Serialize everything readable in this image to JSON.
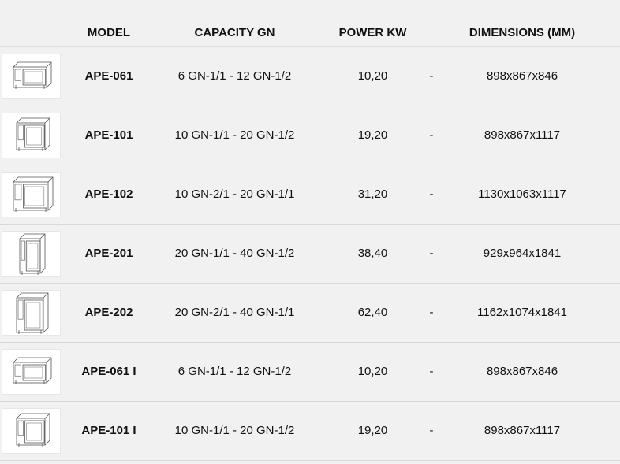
{
  "header": {
    "model": "MODEL",
    "capacity": "CAPACITY GN",
    "power": "POWER KW",
    "dimensions": "DIMENSIONS (MM)"
  },
  "rows": [
    {
      "model": "APE-061",
      "capacity": "6 GN-1/1 - 12 GN-1/2",
      "power": "10,20",
      "sep": "-",
      "dimensions": "898x867x846",
      "image": "oven-compact-icon"
    },
    {
      "model": "APE-101",
      "capacity": "10 GN-1/1 - 20 GN-1/2",
      "power": "19,20",
      "sep": "-",
      "dimensions": "898x867x1117",
      "image": "oven-medium-icon"
    },
    {
      "model": "APE-102",
      "capacity": "10 GN-2/1 - 20 GN-1/1",
      "power": "31,20",
      "sep": "-",
      "dimensions": "1130x1063x1117",
      "image": "oven-wide-icon"
    },
    {
      "model": "APE-201",
      "capacity": "20 GN-1/1 - 40 GN-1/2",
      "power": "38,40",
      "sep": "-",
      "dimensions": "929x964x1841",
      "image": "oven-tall-icon"
    },
    {
      "model": "APE-202",
      "capacity": "20 GN-2/1 - 40 GN-1/1",
      "power": "62,40",
      "sep": "-",
      "dimensions": "1162x1074x1841",
      "image": "oven-tall-wide-icon"
    },
    {
      "model": "APE-061 I",
      "capacity": "6 GN-1/1 - 12 GN-1/2",
      "power": "10,20",
      "sep": "-",
      "dimensions": "898x867x846",
      "image": "oven-compact-icon"
    },
    {
      "model": "APE-101 I",
      "capacity": "10 GN-1/1 - 20 GN-1/2",
      "power": "19,20",
      "sep": "-",
      "dimensions": "898x867x1117",
      "image": "oven-medium-icon"
    }
  ]
}
